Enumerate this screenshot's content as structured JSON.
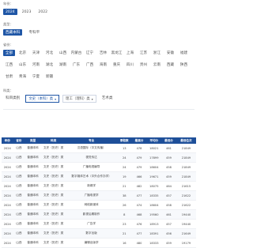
{
  "filters": {
    "year_label": "年份：",
    "years": [
      "2024",
      "2023",
      "2022"
    ],
    "type_label": "类型：",
    "types": [
      "西藏本科",
      "专科平"
    ],
    "province_label": "省份：",
    "provinces": [
      "全部",
      "北京",
      "天津",
      "河北",
      "山西",
      "内蒙古",
      "辽宁",
      "吉林",
      "黑龙江",
      "上海",
      "江苏",
      "浙江",
      "安徽",
      "福建",
      "江西",
      "山东",
      "河南",
      "湖北",
      "湖南",
      "广东",
      "广西",
      "海南",
      "重庆",
      "四川",
      "贵州",
      "云南",
      "西藏",
      "陕西",
      "甘肃",
      "青海",
      "宁夏",
      "新疆"
    ],
    "category_label": "科类：",
    "categories": [
      {
        "label": "科目类别",
        "active": false
      },
      {
        "label": "文史（本科）类",
        "active": true
      },
      {
        "label": "理工（理科）类",
        "active": false
      },
      {
        "label": "艺术类",
        "active": false
      }
    ]
  },
  "table": {
    "headers": [
      "年份",
      "省份",
      "类型",
      "科类",
      "专业",
      "录取数",
      "最高分",
      "平均分",
      "最低分",
      "最低位次"
    ],
    "rows": [
      [
        "2024",
        "山西",
        "普通本科",
        "文史（历史）类",
        "汉语国际（中文传播）",
        "13",
        "478",
        "18021",
        "461",
        "21849"
      ],
      [
        "2024",
        "山西",
        "普通本科",
        "文史（历史）类",
        "视觉传达",
        "24",
        "479",
        "17899",
        "459",
        "21849"
      ],
      [
        "2024",
        "山西",
        "普通本科",
        "文史（历史）类",
        "广播电视编导",
        "24",
        "479",
        "18604",
        "458",
        "21849"
      ],
      [
        "2024",
        "山西",
        "普通本科",
        "文史（历史）类",
        "数字媒体艺术（中外合作办学）",
        "19",
        "466",
        "19671",
        "459",
        "21849"
      ],
      [
        "2024",
        "山西",
        "普通本科",
        "文史（历史）类",
        "新闻学",
        "21",
        "482",
        "18075",
        "464",
        "21615"
      ],
      [
        "2024",
        "山西",
        "普通本科",
        "文史（历史）类",
        "广播电视学",
        "38",
        "477",
        "18335",
        "457",
        "21622"
      ],
      [
        "2024",
        "山西",
        "普通本科",
        "文史（历史）类",
        "网络新媒体",
        "26",
        "474",
        "18604",
        "458",
        "21622"
      ],
      [
        "2024",
        "山西",
        "普通本科",
        "文史（历史）类",
        "影视后期制作",
        "8",
        "468",
        "19560",
        "461",
        "19440"
      ],
      [
        "2024",
        "山西",
        "普通本科",
        "文史（历史）类",
        "广告学",
        "23",
        "476",
        "18913",
        "457",
        "19440"
      ],
      [
        "2024",
        "山西",
        "普通本科",
        "文史（历史）类",
        "数字出版",
        "21",
        "477",
        "18391",
        "456",
        "21649"
      ],
      [
        "2024",
        "山西",
        "普通本科",
        "文史（历史）类",
        "编辑出版学",
        "16",
        "480",
        "18333",
        "459",
        "19179"
      ]
    ]
  }
}
